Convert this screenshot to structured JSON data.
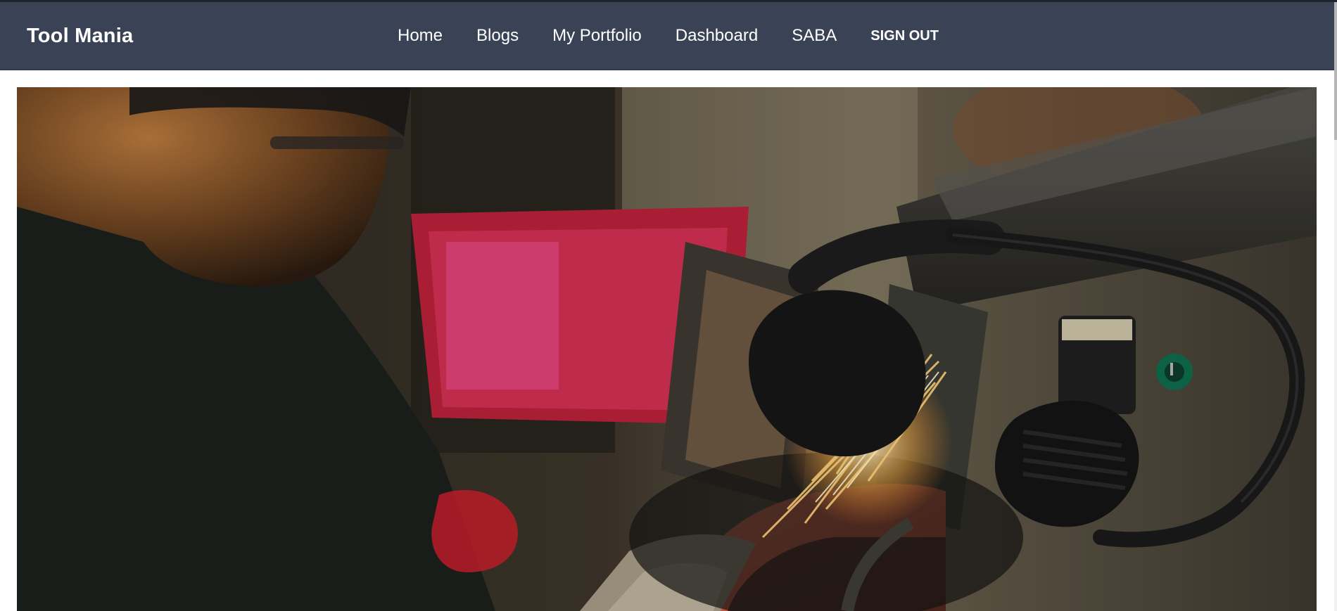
{
  "navbar": {
    "brand": "Tool Mania",
    "links": [
      {
        "label": "Home"
      },
      {
        "label": "Blogs"
      },
      {
        "label": "My Portfolio"
      },
      {
        "label": "Dashboard"
      },
      {
        "label": "SABA"
      },
      {
        "label": "SIGN OUT"
      }
    ]
  },
  "hero": {
    "icon": "photo-hero",
    "colors": {
      "navbar_bg": "#3a4356",
      "spark": "#ffb347",
      "grinder_belt": "#d8553a"
    }
  }
}
